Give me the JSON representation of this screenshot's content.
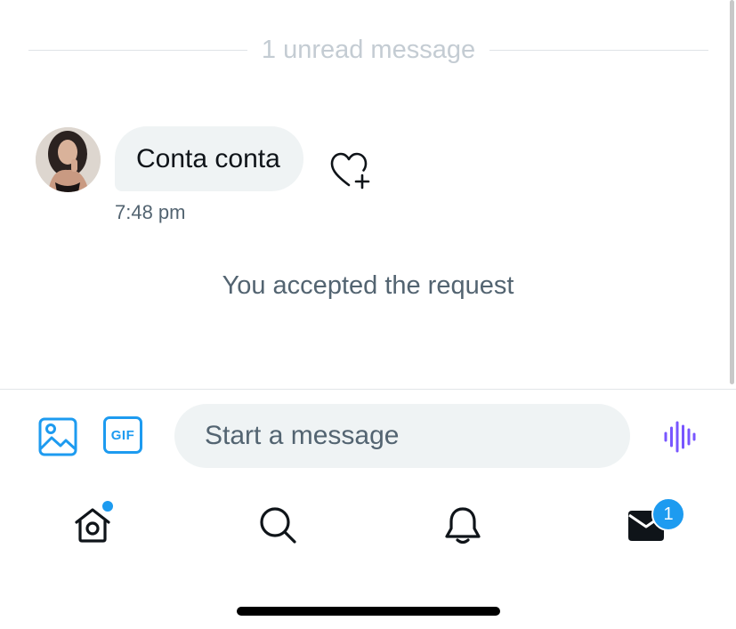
{
  "conversation": {
    "unread_divider": "1 unread message",
    "message": {
      "text": "Conta conta",
      "time": "7:48 pm",
      "react_icon": "heart-plus-icon"
    },
    "system_message": "You accepted the request"
  },
  "composer": {
    "media_icon": "image-icon",
    "gif_label": "GIF",
    "placeholder": "Start a message",
    "voice_icon": "voice-waveform-icon"
  },
  "bottom_nav": {
    "items": [
      {
        "icon": "home-icon",
        "has_dot": true
      },
      {
        "icon": "search-icon"
      },
      {
        "icon": "bell-icon"
      },
      {
        "icon": "mail-icon",
        "badge": "1"
      }
    ]
  },
  "colors": {
    "accent": "#1d9bf0",
    "voice_accent": "#7856ff",
    "bubble_bg": "#eff3f4",
    "secondary_text": "#536471",
    "divider_text": "#c4ccd3"
  }
}
